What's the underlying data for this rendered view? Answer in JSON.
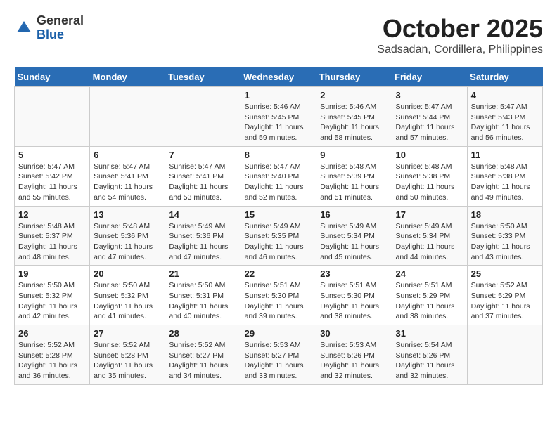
{
  "logo": {
    "general": "General",
    "blue": "Blue"
  },
  "title": "October 2025",
  "subtitle": "Sadsadan, Cordillera, Philippines",
  "weekdays": [
    "Sunday",
    "Monday",
    "Tuesday",
    "Wednesday",
    "Thursday",
    "Friday",
    "Saturday"
  ],
  "weeks": [
    [
      {
        "day": "",
        "sunrise": "",
        "sunset": "",
        "daylight": ""
      },
      {
        "day": "",
        "sunrise": "",
        "sunset": "",
        "daylight": ""
      },
      {
        "day": "",
        "sunrise": "",
        "sunset": "",
        "daylight": ""
      },
      {
        "day": "1",
        "sunrise": "Sunrise: 5:46 AM",
        "sunset": "Sunset: 5:45 PM",
        "daylight": "Daylight: 11 hours and 59 minutes."
      },
      {
        "day": "2",
        "sunrise": "Sunrise: 5:46 AM",
        "sunset": "Sunset: 5:45 PM",
        "daylight": "Daylight: 11 hours and 58 minutes."
      },
      {
        "day": "3",
        "sunrise": "Sunrise: 5:47 AM",
        "sunset": "Sunset: 5:44 PM",
        "daylight": "Daylight: 11 hours and 57 minutes."
      },
      {
        "day": "4",
        "sunrise": "Sunrise: 5:47 AM",
        "sunset": "Sunset: 5:43 PM",
        "daylight": "Daylight: 11 hours and 56 minutes."
      }
    ],
    [
      {
        "day": "5",
        "sunrise": "Sunrise: 5:47 AM",
        "sunset": "Sunset: 5:42 PM",
        "daylight": "Daylight: 11 hours and 55 minutes."
      },
      {
        "day": "6",
        "sunrise": "Sunrise: 5:47 AM",
        "sunset": "Sunset: 5:41 PM",
        "daylight": "Daylight: 11 hours and 54 minutes."
      },
      {
        "day": "7",
        "sunrise": "Sunrise: 5:47 AM",
        "sunset": "Sunset: 5:41 PM",
        "daylight": "Daylight: 11 hours and 53 minutes."
      },
      {
        "day": "8",
        "sunrise": "Sunrise: 5:47 AM",
        "sunset": "Sunset: 5:40 PM",
        "daylight": "Daylight: 11 hours and 52 minutes."
      },
      {
        "day": "9",
        "sunrise": "Sunrise: 5:48 AM",
        "sunset": "Sunset: 5:39 PM",
        "daylight": "Daylight: 11 hours and 51 minutes."
      },
      {
        "day": "10",
        "sunrise": "Sunrise: 5:48 AM",
        "sunset": "Sunset: 5:38 PM",
        "daylight": "Daylight: 11 hours and 50 minutes."
      },
      {
        "day": "11",
        "sunrise": "Sunrise: 5:48 AM",
        "sunset": "Sunset: 5:38 PM",
        "daylight": "Daylight: 11 hours and 49 minutes."
      }
    ],
    [
      {
        "day": "12",
        "sunrise": "Sunrise: 5:48 AM",
        "sunset": "Sunset: 5:37 PM",
        "daylight": "Daylight: 11 hours and 48 minutes."
      },
      {
        "day": "13",
        "sunrise": "Sunrise: 5:48 AM",
        "sunset": "Sunset: 5:36 PM",
        "daylight": "Daylight: 11 hours and 47 minutes."
      },
      {
        "day": "14",
        "sunrise": "Sunrise: 5:49 AM",
        "sunset": "Sunset: 5:36 PM",
        "daylight": "Daylight: 11 hours and 47 minutes."
      },
      {
        "day": "15",
        "sunrise": "Sunrise: 5:49 AM",
        "sunset": "Sunset: 5:35 PM",
        "daylight": "Daylight: 11 hours and 46 minutes."
      },
      {
        "day": "16",
        "sunrise": "Sunrise: 5:49 AM",
        "sunset": "Sunset: 5:34 PM",
        "daylight": "Daylight: 11 hours and 45 minutes."
      },
      {
        "day": "17",
        "sunrise": "Sunrise: 5:49 AM",
        "sunset": "Sunset: 5:34 PM",
        "daylight": "Daylight: 11 hours and 44 minutes."
      },
      {
        "day": "18",
        "sunrise": "Sunrise: 5:50 AM",
        "sunset": "Sunset: 5:33 PM",
        "daylight": "Daylight: 11 hours and 43 minutes."
      }
    ],
    [
      {
        "day": "19",
        "sunrise": "Sunrise: 5:50 AM",
        "sunset": "Sunset: 5:32 PM",
        "daylight": "Daylight: 11 hours and 42 minutes."
      },
      {
        "day": "20",
        "sunrise": "Sunrise: 5:50 AM",
        "sunset": "Sunset: 5:32 PM",
        "daylight": "Daylight: 11 hours and 41 minutes."
      },
      {
        "day": "21",
        "sunrise": "Sunrise: 5:50 AM",
        "sunset": "Sunset: 5:31 PM",
        "daylight": "Daylight: 11 hours and 40 minutes."
      },
      {
        "day": "22",
        "sunrise": "Sunrise: 5:51 AM",
        "sunset": "Sunset: 5:30 PM",
        "daylight": "Daylight: 11 hours and 39 minutes."
      },
      {
        "day": "23",
        "sunrise": "Sunrise: 5:51 AM",
        "sunset": "Sunset: 5:30 PM",
        "daylight": "Daylight: 11 hours and 38 minutes."
      },
      {
        "day": "24",
        "sunrise": "Sunrise: 5:51 AM",
        "sunset": "Sunset: 5:29 PM",
        "daylight": "Daylight: 11 hours and 38 minutes."
      },
      {
        "day": "25",
        "sunrise": "Sunrise: 5:52 AM",
        "sunset": "Sunset: 5:29 PM",
        "daylight": "Daylight: 11 hours and 37 minutes."
      }
    ],
    [
      {
        "day": "26",
        "sunrise": "Sunrise: 5:52 AM",
        "sunset": "Sunset: 5:28 PM",
        "daylight": "Daylight: 11 hours and 36 minutes."
      },
      {
        "day": "27",
        "sunrise": "Sunrise: 5:52 AM",
        "sunset": "Sunset: 5:28 PM",
        "daylight": "Daylight: 11 hours and 35 minutes."
      },
      {
        "day": "28",
        "sunrise": "Sunrise: 5:52 AM",
        "sunset": "Sunset: 5:27 PM",
        "daylight": "Daylight: 11 hours and 34 minutes."
      },
      {
        "day": "29",
        "sunrise": "Sunrise: 5:53 AM",
        "sunset": "Sunset: 5:27 PM",
        "daylight": "Daylight: 11 hours and 33 minutes."
      },
      {
        "day": "30",
        "sunrise": "Sunrise: 5:53 AM",
        "sunset": "Sunset: 5:26 PM",
        "daylight": "Daylight: 11 hours and 32 minutes."
      },
      {
        "day": "31",
        "sunrise": "Sunrise: 5:54 AM",
        "sunset": "Sunset: 5:26 PM",
        "daylight": "Daylight: 11 hours and 32 minutes."
      },
      {
        "day": "",
        "sunrise": "",
        "sunset": "",
        "daylight": ""
      }
    ]
  ]
}
